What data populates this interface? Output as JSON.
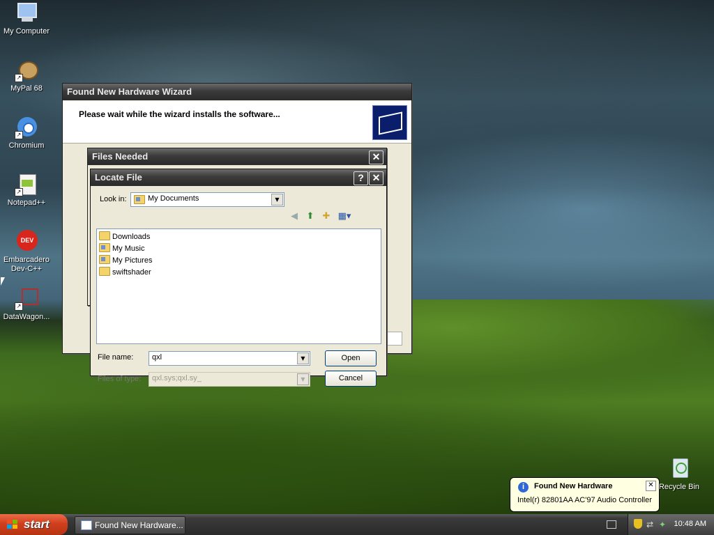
{
  "desktop": {
    "icons": [
      {
        "label": "My Computer"
      },
      {
        "label": "MyPal 68"
      },
      {
        "label": "Chromium"
      },
      {
        "label": "Notepad++"
      },
      {
        "label": "Embarcadero Dev-C++"
      },
      {
        "label": "DataWagon..."
      },
      {
        "label": "Recycle Bin"
      }
    ]
  },
  "wizard": {
    "title": "Found New Hardware Wizard",
    "header_text": "Please wait while the wizard installs the software..."
  },
  "files_needed": {
    "title": "Files Needed"
  },
  "locate_file": {
    "title": "Locate File",
    "help_button": "?",
    "close_button": "✕",
    "look_in_label": "Look in:",
    "look_in_value": "My Documents",
    "items": [
      {
        "name": "Downloads",
        "icon": "folder-icon"
      },
      {
        "name": "My Music",
        "icon": "music-folder-icon"
      },
      {
        "name": "My Pictures",
        "icon": "pictures-folder-icon"
      },
      {
        "name": "swiftshader",
        "icon": "folder-icon"
      }
    ],
    "file_name_label": "File name:",
    "file_name_value": "qxl",
    "files_of_type_label": "Files of type:",
    "files_of_type_value": "qxl.sys;qxl.sy_",
    "open_button": "Open",
    "cancel_button": "Cancel"
  },
  "balloon": {
    "title": "Found New Hardware",
    "text": "Intel(r) 82801AA AC'97 Audio Controller"
  },
  "taskbar": {
    "start_label": "start",
    "task_label": "Found New Hardware...",
    "clock": "10:48 AM"
  },
  "colors": {
    "titlebar": "#2a2a2a",
    "start_button": "#d1401e",
    "balloon_bg": "#ffffe1"
  }
}
